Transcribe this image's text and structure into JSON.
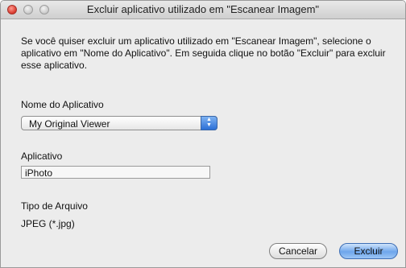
{
  "window": {
    "title": "Excluir aplicativo utilizado em \"Escanear Imagem\""
  },
  "description": "Se você quiser excluir um aplicativo utilizado em \"Escanear Imagem\", selecione o aplicativo em \"Nome do Aplicativo\". Em seguida clique no botão \"Excluir\" para excluir esse aplicativo.",
  "app_name": {
    "label": "Nome do Aplicativo",
    "selected": "My Original Viewer"
  },
  "application": {
    "label": "Aplicativo",
    "value": "iPhoto"
  },
  "file_type": {
    "label": "Tipo de Arquivo",
    "value": "JPEG (*.jpg)"
  },
  "buttons": {
    "cancel": "Cancelar",
    "delete": "Excluir"
  },
  "icons": {
    "popup_arrows": "updown-arrows-icon"
  }
}
